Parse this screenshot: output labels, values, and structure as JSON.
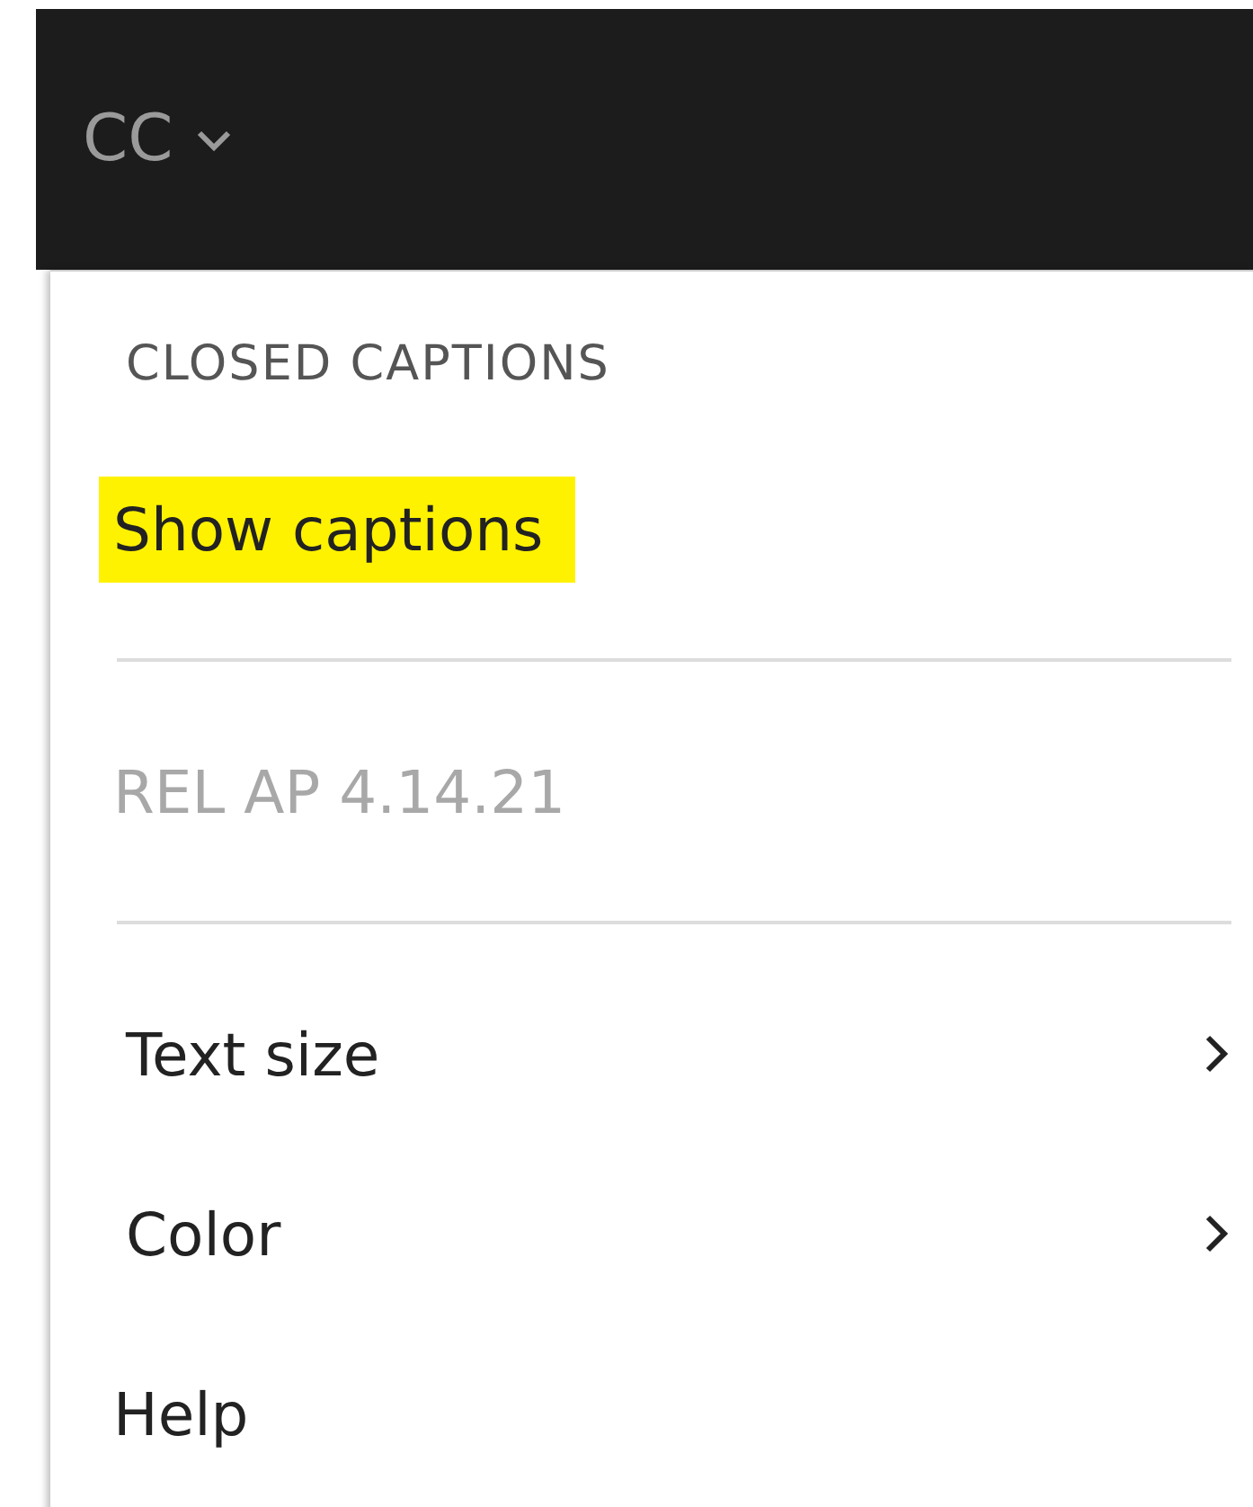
{
  "toolbar": {
    "button_label": "CC"
  },
  "menu": {
    "header": "CLOSED CAPTIONS",
    "items": [
      {
        "kind": "option",
        "label": "Show captions",
        "highlighted": true
      },
      {
        "kind": "divider"
      },
      {
        "kind": "option",
        "label": "REL AP 4.14.21",
        "disabled": true
      },
      {
        "kind": "divider"
      },
      {
        "kind": "submenu",
        "label": "Text size"
      },
      {
        "kind": "submenu",
        "label": "Color"
      },
      {
        "kind": "option",
        "label": "Help"
      }
    ]
  }
}
